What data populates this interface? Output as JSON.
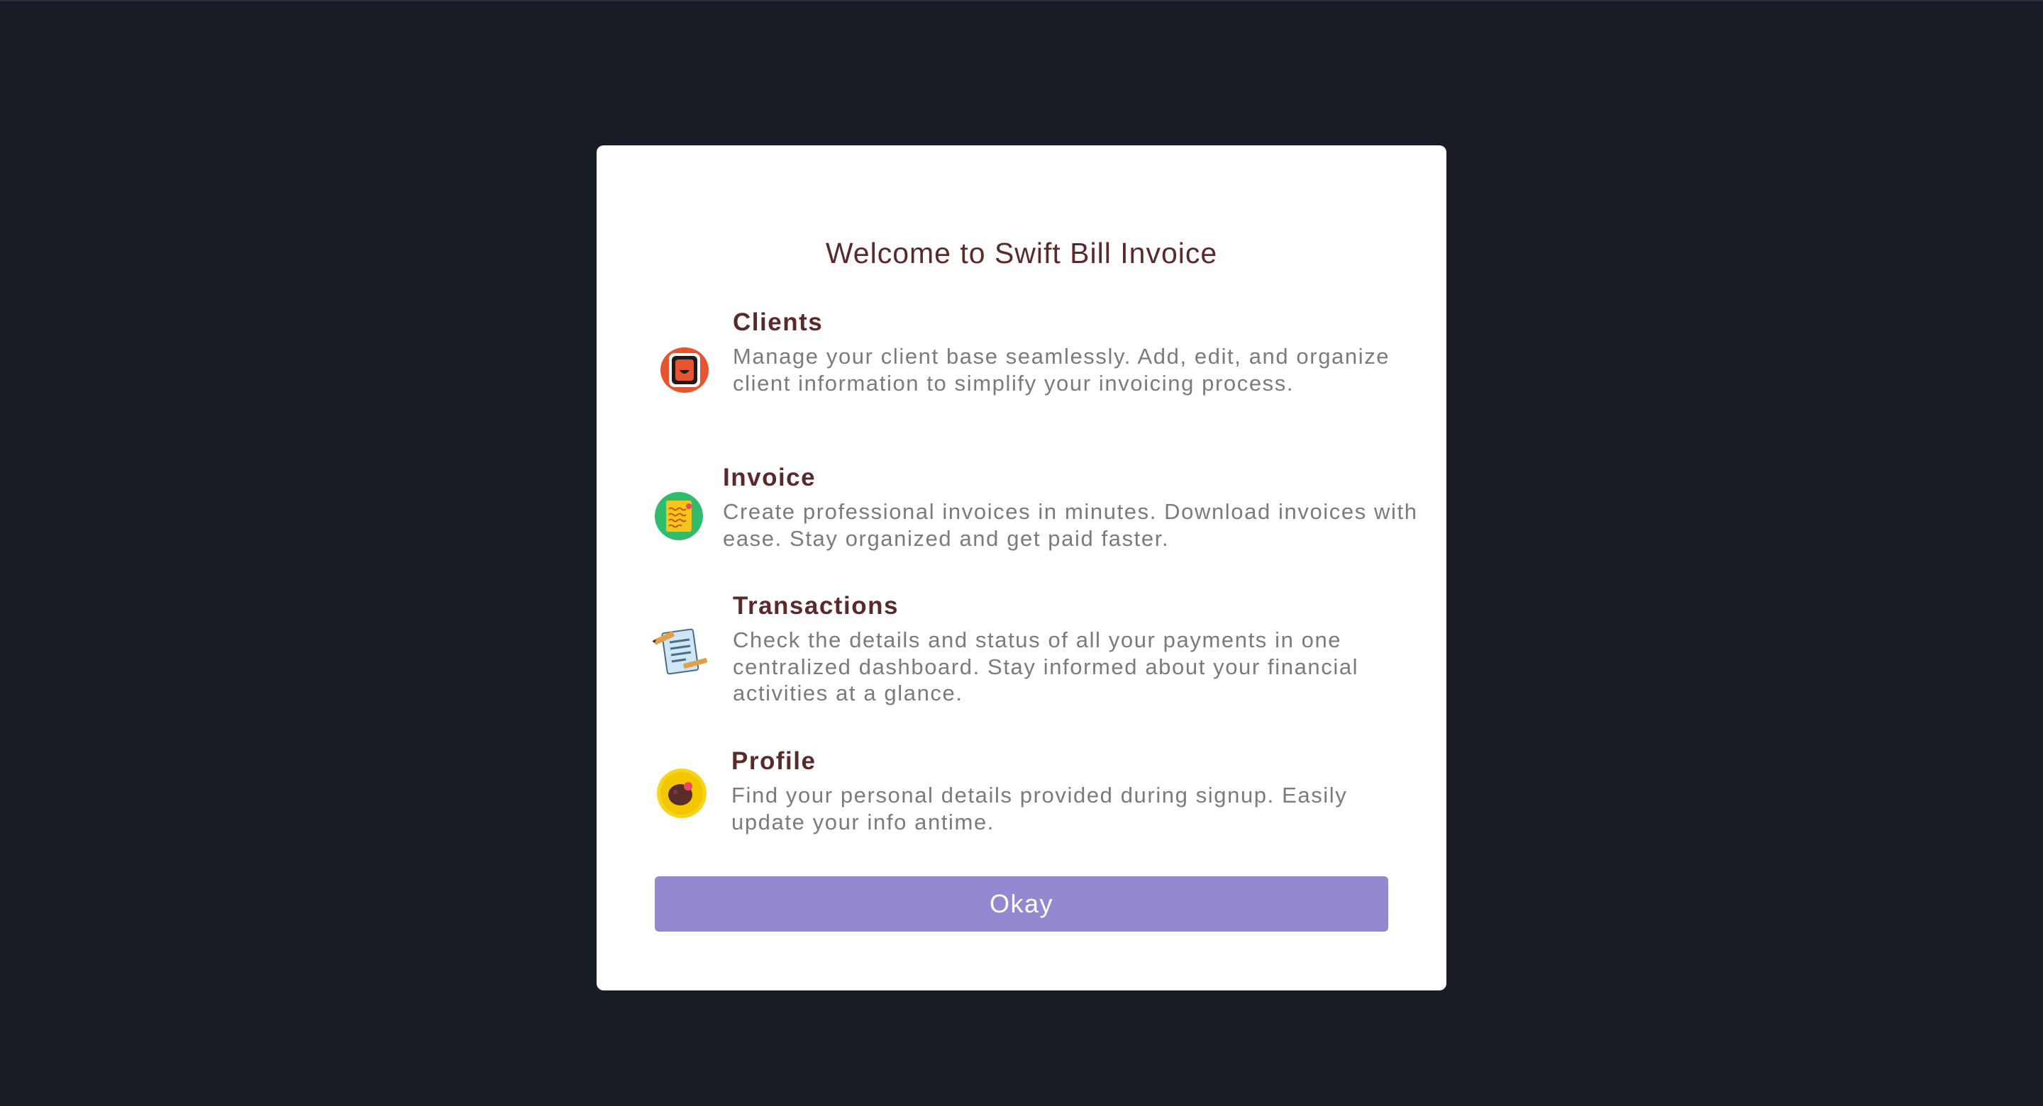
{
  "modal": {
    "title": "Welcome to Swift Bill Invoice",
    "features": [
      {
        "heading": "Clients",
        "description": "Manage your client base seamlessly. Add, edit, and organize client information to simplify your invoicing process.",
        "icon": "clients-icon"
      },
      {
        "heading": "Invoice",
        "description": "Create professional invoices in minutes. Download invoices with ease. Stay organized and get paid faster.",
        "icon": "invoice-icon"
      },
      {
        "heading": "Transactions",
        "description": "Check the details and status of all your payments in one centralized dashboard. Stay informed about your financial activities at a glance.",
        "icon": "transactions-icon"
      },
      {
        "heading": "Profile",
        "description": "Find your personal details provided during signup. Easily update your info antime.",
        "icon": "profile-icon"
      }
    ],
    "button_label": "Okay"
  },
  "colors": {
    "backdrop": "#181c24",
    "title": "#5a2a2a",
    "description": "#7b7b7b",
    "button": "#9389d1"
  }
}
